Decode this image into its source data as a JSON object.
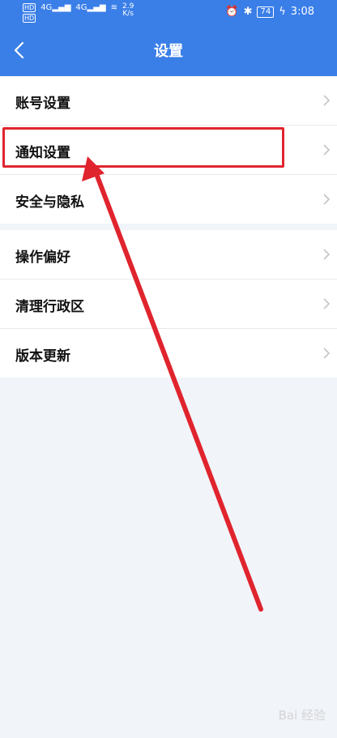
{
  "status_bar": {
    "hd1": "HD",
    "hd2": "HD",
    "net1": "4G",
    "net2": "4G",
    "speed_value": "2.9",
    "speed_unit": "K/s",
    "battery": "74",
    "time": "3:08"
  },
  "header": {
    "title": "设置"
  },
  "groups": [
    {
      "items": [
        {
          "label": "账号设置"
        },
        {
          "label": "通知设置"
        },
        {
          "label": "安全与隐私"
        }
      ]
    },
    {
      "items": [
        {
          "label": "操作偏好"
        },
        {
          "label": "清理行政区"
        },
        {
          "label": "版本更新"
        }
      ]
    }
  ],
  "watermark": "Bai 经验",
  "colors": {
    "header_bg": "#3a7ee8",
    "annotation": "#e0242e",
    "page_bg": "#f1f4f9"
  },
  "icons": {
    "back": "chevron-left-icon",
    "row_arrow": "chevron-right-icon"
  }
}
